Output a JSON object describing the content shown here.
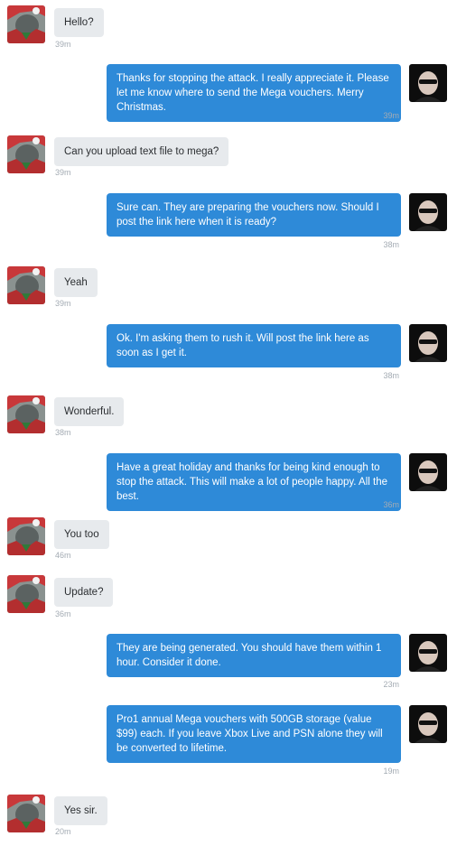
{
  "messages": [
    {
      "side": "in",
      "text": "Hello?",
      "time": "39m"
    },
    {
      "side": "out",
      "text": "Thanks for stopping the attack. I really appreciate it. Please let me know where to send the Mega vouchers. Merry Christmas.",
      "time": "39m"
    },
    {
      "side": "in",
      "text": "Can you upload text file to mega?",
      "time": "39m"
    },
    {
      "side": "out",
      "text": "Sure can. They are preparing the vouchers now. Should I post the link here when it is ready?",
      "time": "38m"
    },
    {
      "side": "in",
      "text": "Yeah",
      "time": "39m"
    },
    {
      "side": "out",
      "text": "Ok. I'm asking them to rush it. Will post the link here as soon as I get it.",
      "time": "38m"
    },
    {
      "side": "in",
      "text": "Wonderful.",
      "time": "38m"
    },
    {
      "side": "out",
      "text": "Have a great holiday and thanks for being kind enough to stop the attack. This will make a lot of people happy. All the best.",
      "time": "36m"
    },
    {
      "side": "in",
      "text": "You too",
      "time": "46m"
    },
    {
      "side": "in",
      "text": "Update?",
      "time": "36m"
    },
    {
      "side": "out",
      "text": "They are being generated. You should have them within 1 hour. Consider it done.",
      "time": "23m"
    },
    {
      "side": "out",
      "text": "Pro1 annual Mega vouchers with 500GB storage (value $99) each. If you leave Xbox Live and PSN alone they will be converted to lifetime.",
      "time": "19m"
    },
    {
      "side": "in",
      "text": "Yes sir.",
      "time": "20m"
    }
  ],
  "colors": {
    "incoming_bubble": "#e7eaed",
    "outgoing_bubble": "#2e8ad8",
    "timestamp": "#a3abb3"
  }
}
